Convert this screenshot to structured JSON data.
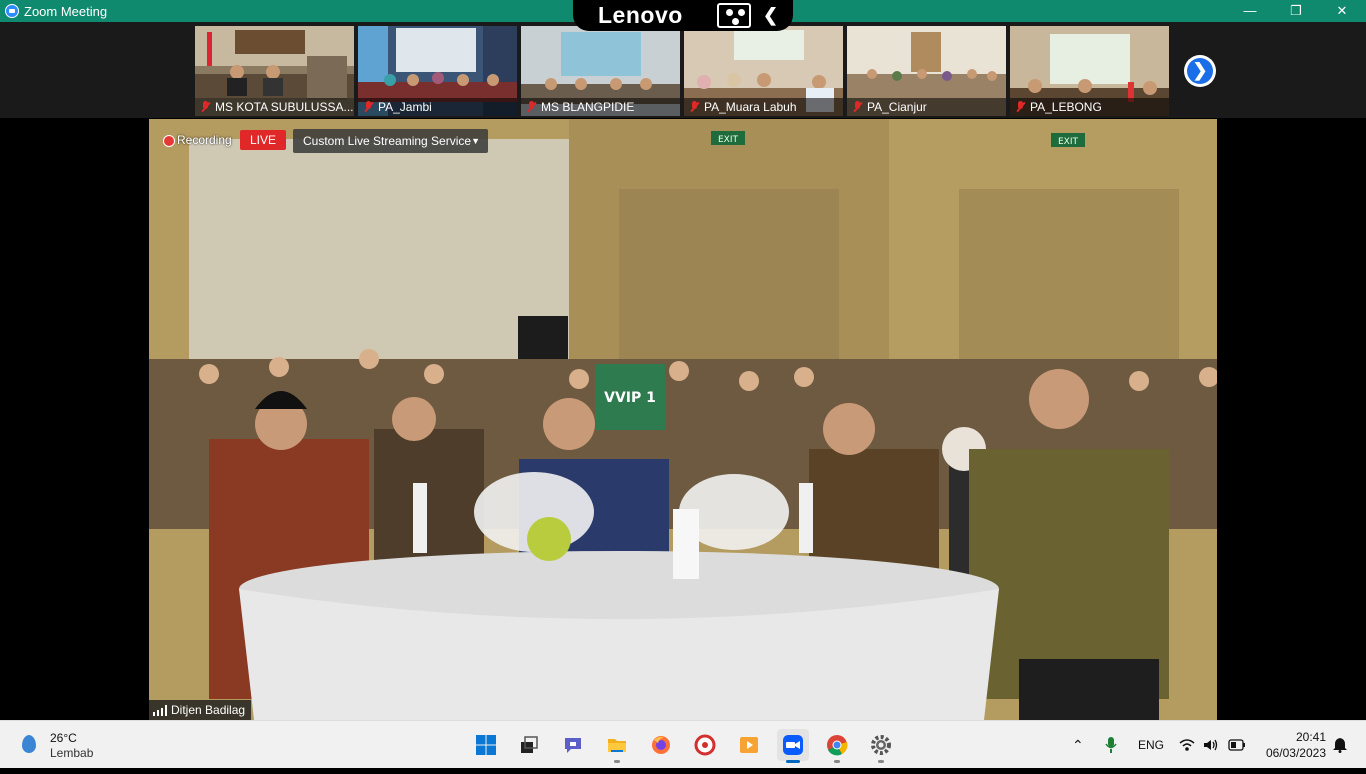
{
  "window": {
    "title": "Zoom Meeting",
    "minimize": "—",
    "maximize": "❐",
    "close": "✕"
  },
  "overlay": {
    "brand": "Lenovo",
    "back": "❮"
  },
  "participants": [
    {
      "name": "MS KOTA SUBULUSSA..."
    },
    {
      "name": "PA_Jambi"
    },
    {
      "name": "MS BLANGPIDIE"
    },
    {
      "name": "PA_Muara Labuh"
    },
    {
      "name": "PA_Cianjur"
    },
    {
      "name": "PA_LEBONG"
    }
  ],
  "next_page_icon": "❯",
  "main_video": {
    "recording_label": "Recording",
    "live_label": "LIVE",
    "stream_service": "Custom Live Streaming Service",
    "speaker_name": "Ditjen Badilag",
    "sign_text": "VVIP 1",
    "exit_text": "EXIT"
  },
  "taskbar": {
    "weather_temp": "26°C",
    "weather_condition": "Lembab",
    "language": "ENG",
    "time": "20:41",
    "date": "06/03/2023",
    "show_hidden_icons": "⌃"
  },
  "colors": {
    "titlebar": "#0f8a6e",
    "live": "#e02828",
    "accent": "#1a6fe8"
  }
}
